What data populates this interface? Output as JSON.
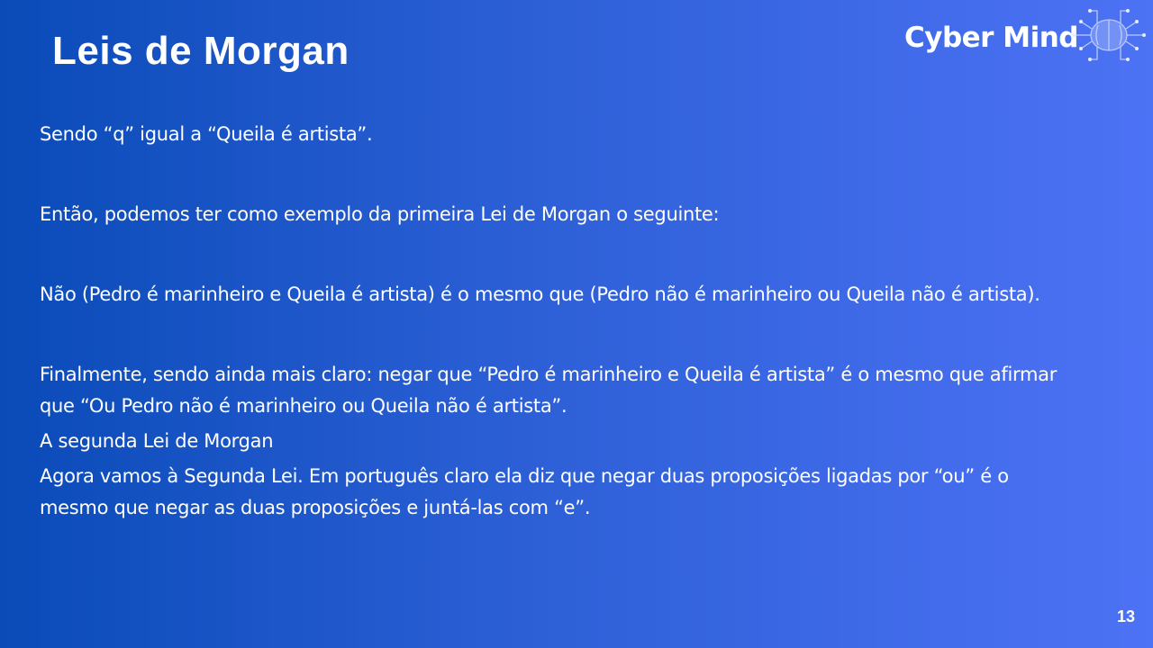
{
  "slide": {
    "title": "Leis de Morgan",
    "logo": {
      "text": "Cyber Mind",
      "icon": "brain-circuit-icon"
    },
    "paragraphs": [
      "Sendo “q” igual a “Queila é artista”.",
      "Então, podemos ter como exemplo da primeira Lei de Morgan o seguinte:",
      "Não (Pedro é marinheiro e Queila é artista) é o mesmo que (Pedro não é marinheiro ou Queila não é artista).",
      "Finalmente, sendo ainda mais claro: negar que “Pedro é marinheiro e Queila é artista” é o mesmo que afirmar que “Ou Pedro não é marinheiro ou Queila não é artista”.",
      "A segunda Lei de Morgan",
      "Agora vamos à Segunda Lei. Em português claro ela diz que negar duas proposições ligadas por “ou” é o mesmo que negar as duas proposições e juntá-las com “e”."
    ],
    "page_number": "13",
    "colors": {
      "background_start": "#0a4bb8",
      "background_end": "#4d72f5",
      "text": "#ffffff"
    }
  }
}
